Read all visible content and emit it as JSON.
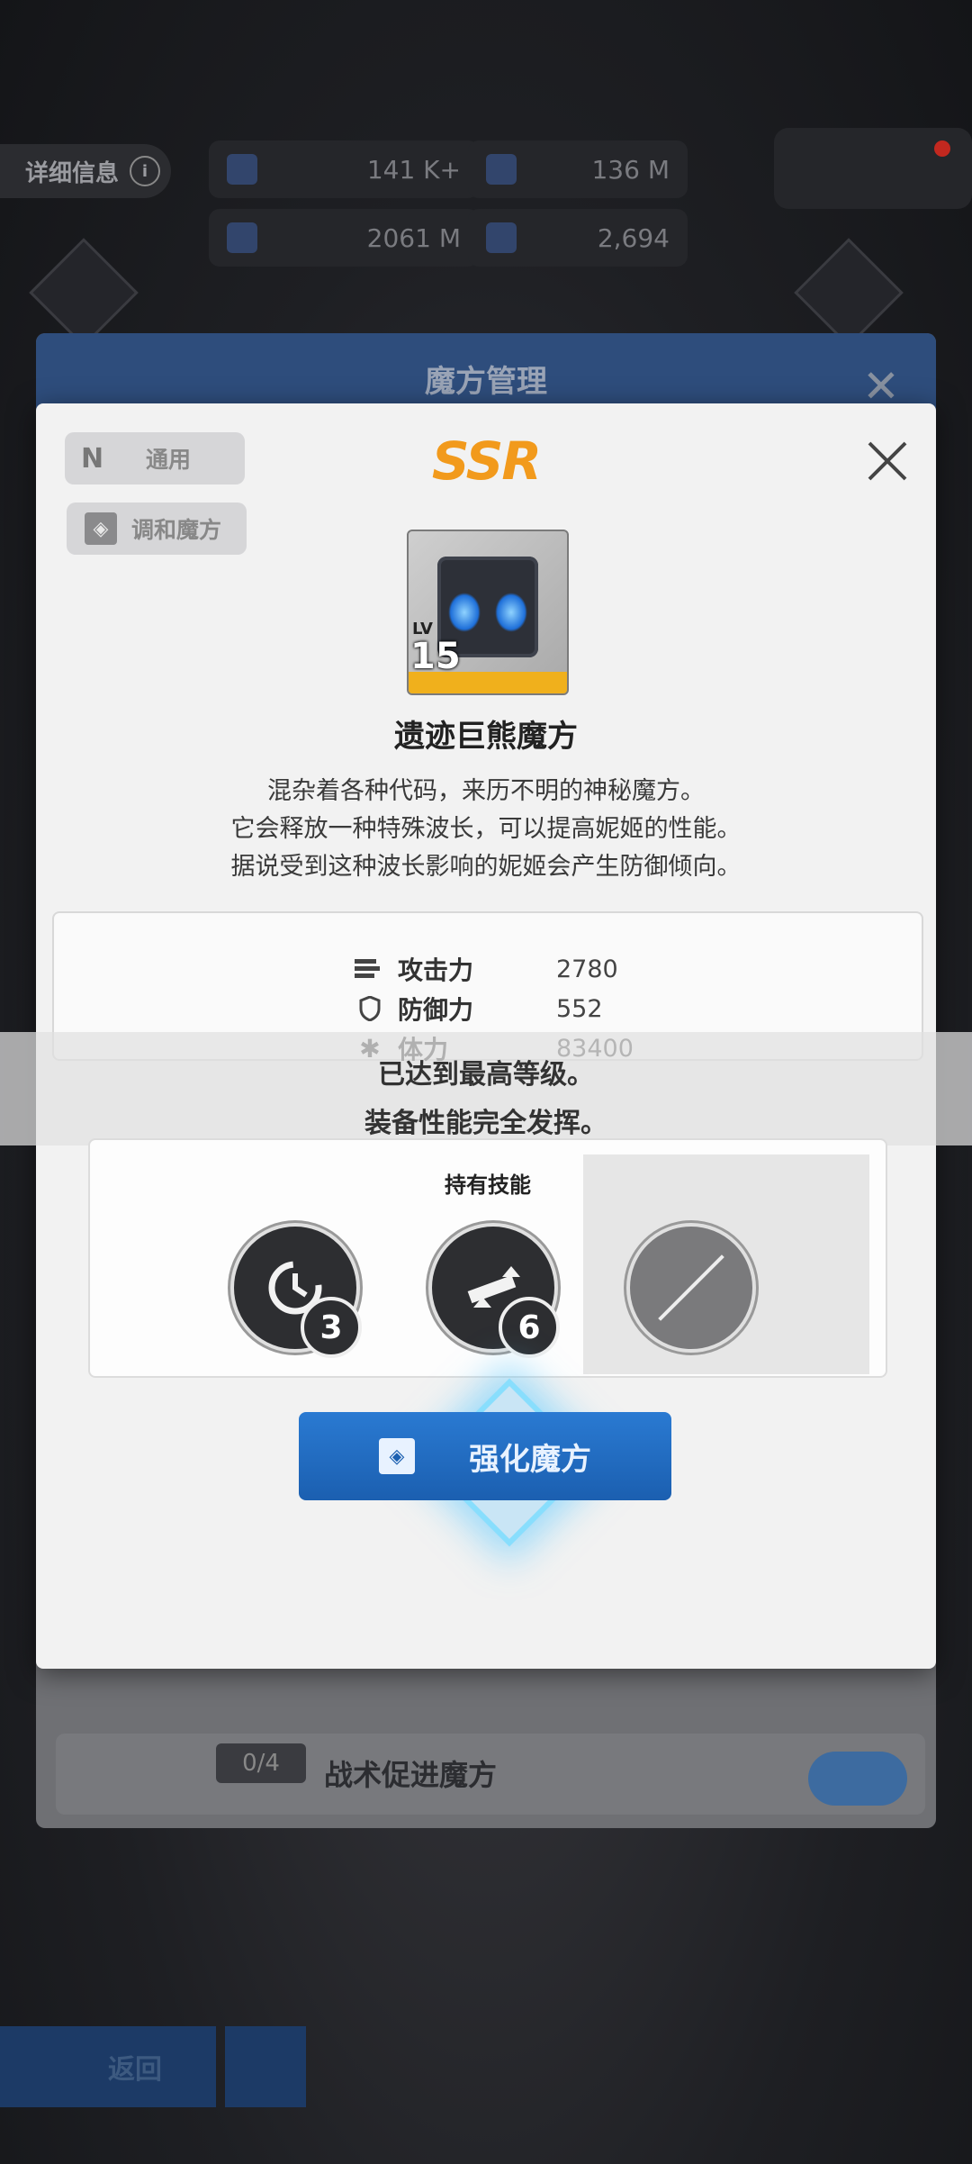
{
  "hud": {
    "info_label": "详细信息",
    "res1": "141 K+",
    "res2": "136 M",
    "res3": "2061 M",
    "res4": "2,694"
  },
  "underlying": {
    "title": "魔方管理",
    "row_tag": "0/4",
    "row_label": "战术促进魔方",
    "back_label": "返回"
  },
  "modal": {
    "tag_type": "通用",
    "tag_type_mark": "N",
    "tag_category": "调和魔方",
    "rarity": "SSR",
    "item": {
      "lv_label": "LV",
      "level": "15",
      "name": "遗迹巨熊魔方"
    },
    "description": [
      "混杂着各种代码，来历不明的神秘魔方。",
      "它会释放一种特殊波长，可以提高妮姬的性能。",
      "据说受到这种波长影响的妮姬会产生防御倾向。"
    ],
    "stats": [
      {
        "name": "攻击力",
        "value": "2780"
      },
      {
        "name": "防御力",
        "value": "552"
      },
      {
        "name": "体力",
        "value": "83400"
      }
    ],
    "max_message": [
      "已达到最高等级。",
      "装备性能完全发挥。"
    ],
    "skills_title": "持有技能",
    "skills": [
      {
        "level": "3",
        "icon": "cooldown-icon"
      },
      {
        "level": "6",
        "icon": "gun-upgrade-icon"
      },
      {
        "level": "",
        "icon": "empty-slot-icon"
      }
    ],
    "enhance_label": "强化魔方"
  }
}
